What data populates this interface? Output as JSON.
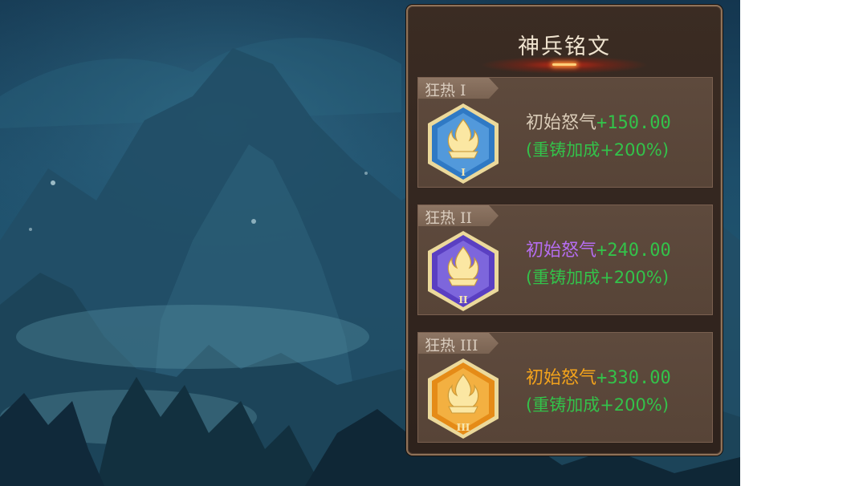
{
  "panel": {
    "title": "神兵铭文",
    "items": [
      {
        "tag": "狂热 I",
        "roman": "I",
        "stat_name": "初始怒气",
        "stat_value": "+150.00",
        "bonus": "(重铸加成+200%)",
        "name_color": "#d9cbb7",
        "emblem_color": "#2f79c4",
        "emblem_light": "#6fb4ef"
      },
      {
        "tag": "狂热 II",
        "roman": "II",
        "stat_name": "初始怒气",
        "stat_value": "+240.00",
        "bonus": "(重铸加成+200%)",
        "name_color": "#b56df0",
        "emblem_color": "#5a3fc2",
        "emblem_light": "#9b86f2"
      },
      {
        "tag": "狂热 III",
        "roman": "III",
        "stat_name": "初始怒气",
        "stat_value": "+330.00",
        "bonus": "(重铸加成+200%)",
        "name_color": "#f3a31c",
        "emblem_color": "#e58b17",
        "emblem_light": "#ffd064"
      }
    ]
  },
  "colors": {
    "value_green": "#33c24a",
    "panel_border": "#8f7259"
  },
  "icons": {
    "emblem": "flame-hexagon-icon"
  }
}
